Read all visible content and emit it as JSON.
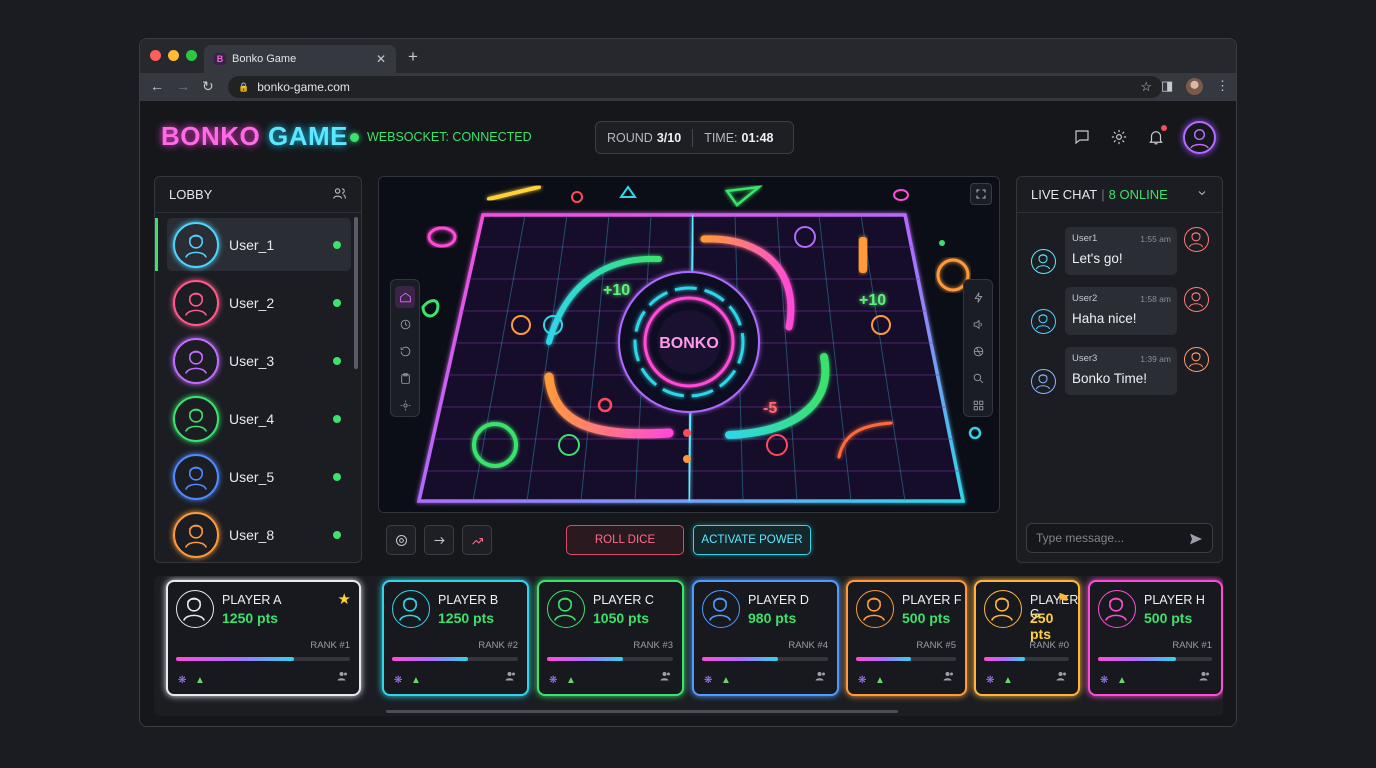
{
  "browser": {
    "tab_title": "Bonko Game",
    "tab_favicon": "B",
    "url": "bonko-game.com"
  },
  "header": {
    "logo_part1": "BONKO",
    "logo_part2": "GAME",
    "ws_status": "WEBSOCKET: CONNECTED",
    "round_label": "ROUND",
    "round_value": "3/10",
    "time_label": "TIME:",
    "time_value": "01:48"
  },
  "lobby": {
    "title": "LOBBY",
    "users": [
      {
        "name": "User_1",
        "color": "#4fd3ff"
      },
      {
        "name": "User_2",
        "color": "#ff5a8a"
      },
      {
        "name": "User_3",
        "color": "#c26bff"
      },
      {
        "name": "User_4",
        "color": "#3be26b"
      },
      {
        "name": "User_5",
        "color": "#4f8bff"
      },
      {
        "name": "User_8",
        "color": "#ff9a3b"
      }
    ]
  },
  "board": {
    "center_label": "BONKO",
    "score_a": "+10",
    "score_b": "+10",
    "score_c": "-5"
  },
  "controls": {
    "roll_label": "ROLL DICE",
    "power_label": "ACTIVATE POWER"
  },
  "chat": {
    "title": "LIVE CHAT",
    "online": "8 ONLINE",
    "messages": [
      {
        "user": "User1",
        "time": "1:55 am",
        "text": "Let's go!"
      },
      {
        "user": "User2",
        "time": "1:58 am",
        "text": "Haha nice!"
      },
      {
        "user": "User3",
        "time": "1:39 am",
        "text": "Bonko Time!"
      }
    ],
    "input_placeholder": "Type message..."
  },
  "players": [
    {
      "name": "PLAYER A",
      "points": "1250 pts",
      "rank": "RANK #1",
      "progress": 0.68,
      "border": "#e8e8ee",
      "pts_color": "#3be26b",
      "badge": "★"
    },
    {
      "name": "PLAYER B",
      "points": "1250 pts",
      "rank": "RANK #2",
      "progress": 0.6,
      "border": "#2fd6e8",
      "pts_color": "#3be26b",
      "badge": ""
    },
    {
      "name": "PLAYER C",
      "points": "1050 pts",
      "rank": "RANK #3",
      "progress": 0.6,
      "border": "#3be26b",
      "pts_color": "#3be26b",
      "badge": ""
    },
    {
      "name": "PLAYER D",
      "points": "980 pts",
      "rank": "RANK #4",
      "progress": 0.6,
      "border": "#4f9bff",
      "pts_color": "#3be26b",
      "badge": ""
    },
    {
      "name": "PLAYER F",
      "points": "500 pts",
      "rank": "RANK #5",
      "progress": 0.55,
      "border": "#ff9a3b",
      "pts_color": "#3be26b",
      "badge": ""
    },
    {
      "name": "PLAYER G",
      "points": "250 pts",
      "rank": "RANK #0",
      "progress": 0.48,
      "border": "#ffb53b",
      "pts_color": "#ffd23b",
      "badge": "⚑"
    },
    {
      "name": "PLAYER H",
      "points": "500 pts",
      "rank": "RANK #1",
      "progress": 0.68,
      "border": "#ff4bd8",
      "pts_color": "#3be26b",
      "badge": ""
    }
  ]
}
